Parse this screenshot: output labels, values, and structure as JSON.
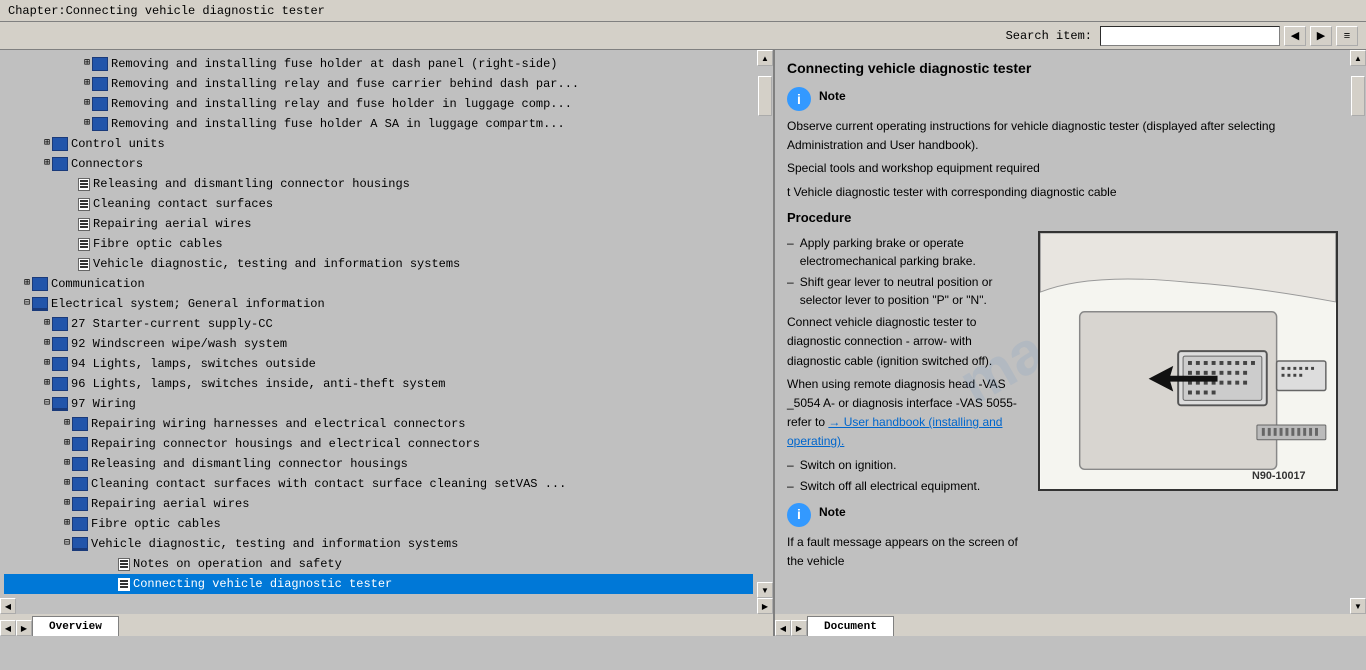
{
  "titleBar": {
    "text": "Chapter:Connecting vehicle diagnostic tester"
  },
  "toolbar": {
    "searchLabel": "Search item:",
    "searchPlaceholder": "",
    "buttons": [
      "🔍",
      "🔍",
      "≡"
    ]
  },
  "leftPanel": {
    "treeItems": [
      {
        "indent": 80,
        "type": "book",
        "expandable": true,
        "text": "Removing and installing fuse holder at dash panel (right-side)"
      },
      {
        "indent": 80,
        "type": "book",
        "expandable": true,
        "text": "Removing and installing relay and fuse carrier behind dash par..."
      },
      {
        "indent": 80,
        "type": "book",
        "expandable": true,
        "text": "Removing and installing relay and fuse holder in luggage comp..."
      },
      {
        "indent": 80,
        "type": "book",
        "expandable": true,
        "text": "Removing and installing fuse holder A SA in luggage compartm..."
      },
      {
        "indent": 40,
        "type": "book",
        "expandable": true,
        "text": "Control units"
      },
      {
        "indent": 40,
        "type": "book",
        "expandable": true,
        "text": "Connectors"
      },
      {
        "indent": 60,
        "type": "page",
        "expandable": false,
        "text": "Releasing and dismantling connector housings"
      },
      {
        "indent": 60,
        "type": "page",
        "expandable": false,
        "text": "Cleaning contact surfaces"
      },
      {
        "indent": 60,
        "type": "page",
        "expandable": false,
        "text": "Repairing aerial wires"
      },
      {
        "indent": 60,
        "type": "page",
        "expandable": false,
        "text": "Fibre optic cables"
      },
      {
        "indent": 60,
        "type": "page",
        "expandable": false,
        "text": "Vehicle diagnostic, testing and information systems"
      },
      {
        "indent": 20,
        "type": "book",
        "expandable": true,
        "text": "Communication"
      },
      {
        "indent": 20,
        "type": "bookopen",
        "expandable": true,
        "text": "Electrical system; General information"
      },
      {
        "indent": 40,
        "type": "book",
        "expandable": true,
        "text": "27 Starter-current supply-CC"
      },
      {
        "indent": 40,
        "type": "book",
        "expandable": true,
        "text": "92 Windscreen wipe/wash system"
      },
      {
        "indent": 40,
        "type": "book",
        "expandable": true,
        "text": "94 Lights, lamps, switches outside"
      },
      {
        "indent": 40,
        "type": "book",
        "expandable": true,
        "text": "96 Lights, lamps, switches inside, anti-theft system"
      },
      {
        "indent": 40,
        "type": "bookopen",
        "expandable": true,
        "text": "97 Wiring"
      },
      {
        "indent": 60,
        "type": "book",
        "expandable": true,
        "text": "Repairing wiring harnesses and electrical connectors"
      },
      {
        "indent": 60,
        "type": "book",
        "expandable": true,
        "text": "Repairing connector housings and electrical connectors"
      },
      {
        "indent": 60,
        "type": "book",
        "expandable": true,
        "text": "Releasing and dismantling connector housings"
      },
      {
        "indent": 60,
        "type": "book",
        "expandable": true,
        "text": "Cleaning contact surfaces with contact surface cleaning setVAS..."
      },
      {
        "indent": 60,
        "type": "book",
        "expandable": true,
        "text": "Repairing aerial wires"
      },
      {
        "indent": 60,
        "type": "book",
        "expandable": true,
        "text": "Fibre optic cables"
      },
      {
        "indent": 60,
        "type": "bookopen",
        "expandable": true,
        "text": "Vehicle diagnostic, testing and information systems"
      },
      {
        "indent": 80,
        "type": "page",
        "expandable": false,
        "text": "Notes on operation and safety"
      },
      {
        "indent": 80,
        "type": "page",
        "expandable": false,
        "text": "Connecting vehicle diagnostic tester",
        "selected": true
      }
    ]
  },
  "rightPanel": {
    "title": "Connecting vehicle diagnostic tester",
    "noteLabel": "Note",
    "noteText": "Observe current operating instructions for vehicle diagnostic tester (displayed after selecting Administration and User handbook).",
    "specialTools": "Special tools and workshop equipment required",
    "toolItem": "t  Vehicle diagnostic tester with corresponding diagnostic cable",
    "procedureLabel": "Procedure",
    "steps": [
      "Apply parking brake or operate electromechanical parking brake.",
      "Shift gear lever to neutral position or selector lever to position \"P\" or \"N\".",
      "Connect vehicle diagnostic tester to diagnostic connection - arrow- with diagnostic cable (ignition switched off).",
      "When using remote diagnosis head -VAS 5054 A- or diagnosis interface -VAS 5055- refer to",
      "Switch on ignition.",
      "Switch off all electrical equipment."
    ],
    "connectText": "Connect vehicle diagnostic tester to diagnostic connection - arrow- with diagnostic cable (ignition switched off).",
    "vasText": "When using remote diagnosis head -VAS _5054 A- or diagnosis interface -VAS 5055- refer to",
    "linkText": "→ User handbook (installing and operating).",
    "switchOn": "– Switch on ignition.",
    "switchOff": "– Switch off all electrical equipment.",
    "note2Label": "Note",
    "note2Text": "If a fault message appears on the screen of the vehicle",
    "diagramLabel": "N90-10017",
    "arrowText": "arrow - With diagnostic"
  },
  "bottomTabs": {
    "left": "Overview",
    "right": "Document"
  }
}
